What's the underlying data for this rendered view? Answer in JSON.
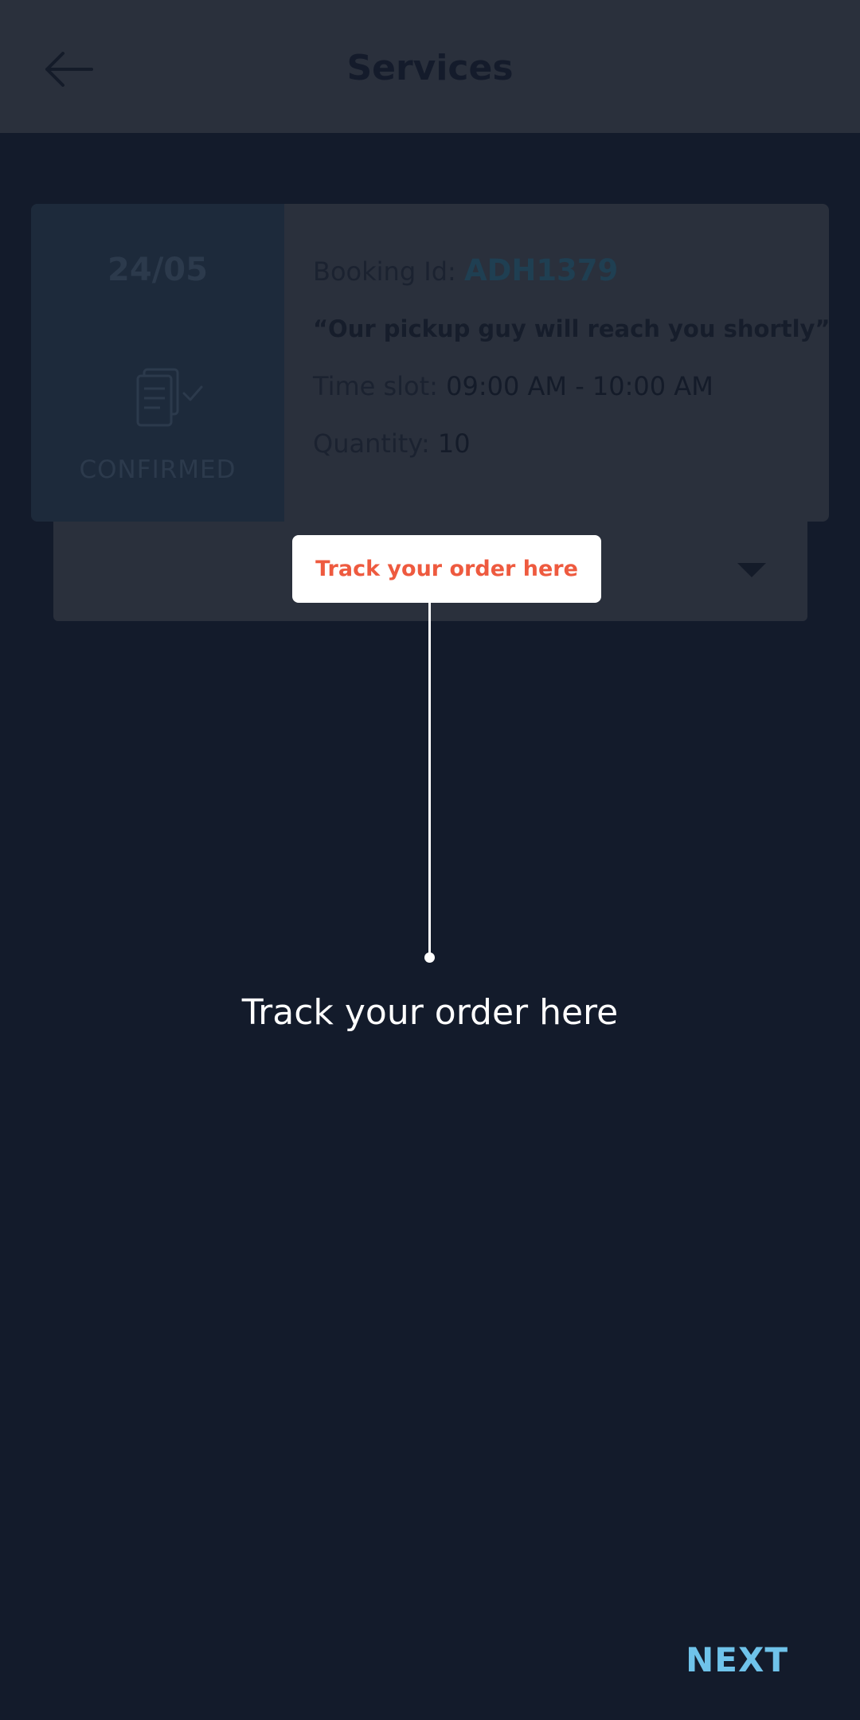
{
  "header": {
    "title": "Services",
    "back_icon": "arrow-left-icon"
  },
  "booking": {
    "date": "24/05",
    "status": "CONFIRMED",
    "status_icon": "documents-check-icon",
    "booking_id_label": "Booking Id:",
    "booking_id_value": "ADH1379",
    "message": "“Our pickup guy will reach you shortly”",
    "time_slot_label": "Time slot:",
    "time_slot_value": "09:00 AM - 10:00 AM",
    "quantity_label": "Quantity:",
    "quantity_value": "10"
  },
  "tracking": {
    "dropdown_icon": "caret-down-icon"
  },
  "coach_mark": {
    "pill_label": "Track your order here",
    "description": "Track your order here"
  },
  "footer": {
    "next_label": "NEXT"
  },
  "colors": {
    "background": "#131b2b",
    "coach_accent": "#ee5a3f",
    "next": "#6fc3ea"
  }
}
